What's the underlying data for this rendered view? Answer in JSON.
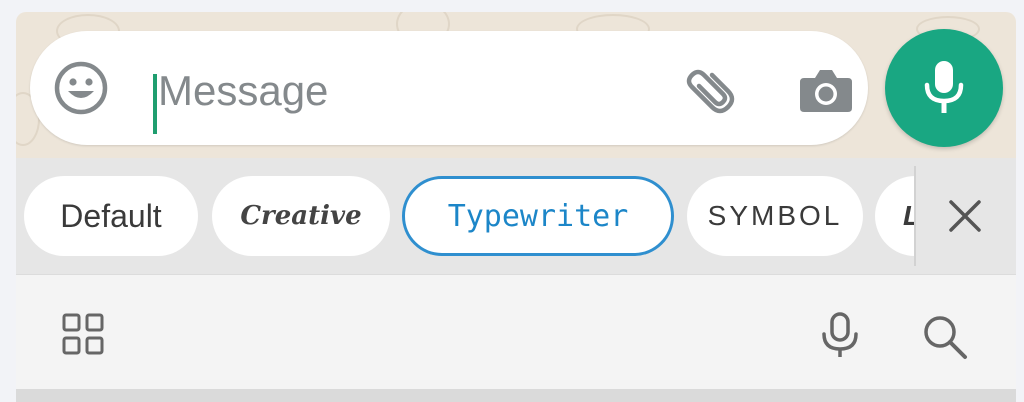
{
  "composer": {
    "placeholder": "Message",
    "value": ""
  },
  "icons": {
    "emoji": "emoji-smiley-icon",
    "attach": "paperclip-icon",
    "camera": "camera-icon",
    "mic": "microphone-icon",
    "close": "close-x-icon",
    "apps": "grid-apps-icon",
    "voice": "microphone-outline-icon",
    "search": "search-icon"
  },
  "font_styles": {
    "items": [
      {
        "label": "Default"
      },
      {
        "label": "Creative"
      },
      {
        "label": "Typewriter",
        "selected": true
      },
      {
        "label": "SYMBOL"
      },
      {
        "label": "L"
      }
    ]
  },
  "colors": {
    "accent_green": "#19a782",
    "selected_chip_blue": "#2f8fcf",
    "chat_background": "#ede5d9"
  }
}
